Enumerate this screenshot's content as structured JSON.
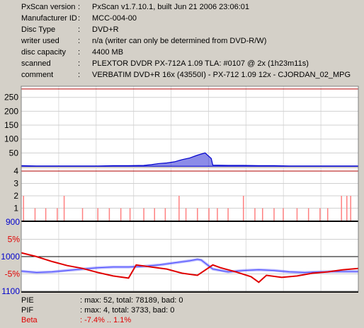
{
  "info": [
    {
      "key": "PxScan version",
      "value": "PxScan v1.7.10.1, built Jun 21 2006 23:06:01"
    },
    {
      "key": "Manufacturer ID",
      "value": "MCC-004-00"
    },
    {
      "key": "Disc Type",
      "value": "DVD+R"
    },
    {
      "key": "writer used",
      "value": "n/a (writer can only be determined from DVD-R/W)"
    },
    {
      "key": "disc capacity",
      "value": "4400 MB"
    },
    {
      "key": "scanned",
      "value": "PLEXTOR DVDR PX-712A 1.09 TLA: #0107 @ 2x (1h23m11s)"
    },
    {
      "key": "comment",
      "value": "VERBATIM DVD+R 16x (43550I) - PX-712 1.09 12x - CJORDAN_02_MPG"
    }
  ],
  "info_separator": ":",
  "stats": [
    {
      "key": "PIE",
      "value": ": max: 52, total: 78189, bad: 0",
      "color": "#000000"
    },
    {
      "key": "PIF",
      "value": ": max: 4, total: 3733, bad: 0",
      "color": "#000000"
    },
    {
      "key": "Beta",
      "value": ": -7.4% .. 1.1%",
      "color": "#e00000"
    }
  ],
  "colors": {
    "background": "#d4d0c8",
    "plot_background": "#ffffff",
    "pie": "#0000cc",
    "pif": "#ff8080",
    "beta": "#e00000",
    "jitter": "#4040ff",
    "limit_line": "#b00000"
  },
  "chart_data": [
    {
      "type": "area",
      "name": "PIE",
      "ylim": [
        0,
        290
      ],
      "yticks": [
        "250",
        "200",
        "150",
        "100",
        "50"
      ],
      "ytick_values": [
        250,
        200,
        150,
        100,
        50
      ],
      "limit": 280,
      "xlim": [
        0,
        4400
      ],
      "x": [
        0,
        200,
        400,
        600,
        800,
        1000,
        1200,
        1400,
        1600,
        1700,
        1800,
        1900,
        2000,
        2100,
        2200,
        2300,
        2400,
        2480,
        2500,
        2700,
        2900,
        3100,
        3300,
        3500,
        3700,
        3900,
        4100,
        4300,
        4400
      ],
      "values": [
        4,
        3,
        3,
        3,
        3,
        3,
        4,
        4,
        5,
        8,
        12,
        14,
        18,
        26,
        32,
        42,
        50,
        30,
        6,
        5,
        5,
        4,
        4,
        3,
        3,
        3,
        3,
        3,
        3
      ]
    },
    {
      "type": "bar",
      "name": "PIF",
      "ylim": [
        0,
        4
      ],
      "yticks": [
        "4",
        "3",
        "2",
        "1"
      ],
      "ytick_values": [
        4,
        3,
        2,
        1
      ],
      "limit": 4,
      "xlim": [
        0,
        4400
      ],
      "x": [
        30,
        180,
        320,
        470,
        560,
        800,
        1000,
        1150,
        1300,
        1420,
        1600,
        1740,
        1880,
        2060,
        2150,
        2300,
        2450,
        2560,
        2700,
        2900,
        3050,
        3150,
        3300,
        3420,
        3600,
        3750,
        3900,
        4000,
        4180,
        4250,
        4300
      ],
      "values": [
        2,
        1,
        1,
        1,
        2,
        1,
        1,
        1,
        1,
        1,
        1,
        1,
        1,
        2,
        1,
        1,
        1,
        1,
        1,
        2,
        1,
        1,
        1,
        1,
        1,
        1,
        1,
        1,
        2,
        2,
        2
      ]
    },
    {
      "type": "line",
      "name": "Beta / Jitter",
      "yticks_left_red": [
        "5%",
        "-5%"
      ],
      "yticks_left_blue": [
        "900",
        "1000",
        "1100"
      ],
      "beta_ylim": [
        -10,
        10
      ],
      "jitter_ylim": [
        900,
        1100
      ],
      "xlim": [
        0,
        4400
      ],
      "beta": {
        "x": [
          0,
          200,
          400,
          600,
          800,
          1000,
          1200,
          1400,
          1500,
          1700,
          1900,
          2100,
          2300,
          2500,
          2600,
          2800,
          3000,
          3100,
          3200,
          3400,
          3600,
          3800,
          4000,
          4200,
          4400
        ],
        "values": [
          1.1,
          0.0,
          -1.4,
          -2.6,
          -3.4,
          -4.6,
          -5.6,
          -6.2,
          -2.4,
          -3.0,
          -3.6,
          -4.8,
          -5.4,
          -2.4,
          -3.2,
          -4.4,
          -5.8,
          -7.4,
          -5.4,
          -6.0,
          -5.6,
          -4.8,
          -4.4,
          -3.8,
          -3.4
        ]
      },
      "jitter": {
        "x": [
          0,
          200,
          400,
          600,
          800,
          1000,
          1200,
          1400,
          1600,
          1800,
          2000,
          2200,
          2300,
          2350,
          2500,
          2700,
          2900,
          3100,
          3300,
          3500,
          3700,
          3900,
          4100,
          4300,
          4400
        ],
        "values": [
          1042,
          1046,
          1044,
          1040,
          1036,
          1032,
          1030,
          1030,
          1028,
          1024,
          1018,
          1012,
          1008,
          1010,
          1036,
          1044,
          1040,
          1038,
          1040,
          1044,
          1046,
          1044,
          1043,
          1043,
          1043
        ]
      }
    }
  ]
}
